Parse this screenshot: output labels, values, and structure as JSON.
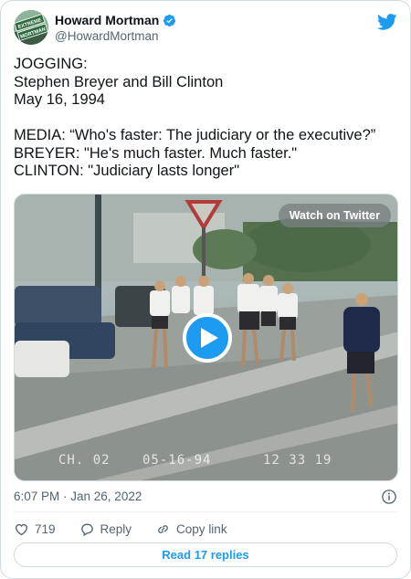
{
  "author": {
    "display_name": "Howard Mortman",
    "handle": "@HowardMortman",
    "verified": true,
    "avatar_text": [
      "EXTREME",
      "MORTMAN"
    ]
  },
  "tweet": {
    "lines": [
      "JOGGING:",
      "Stephen Breyer and Bill Clinton",
      "May 16, 1994",
      "",
      "MEDIA: “Who's faster: The judiciary or the executive?”",
      "BREYER: \"He's much faster. Much faster.\"",
      "CLINTON: \"Judiciary lasts longer\""
    ]
  },
  "media": {
    "watch_label": "Watch on Twitter",
    "vhs_channel": "CH. 02",
    "vhs_date": "05-16-94",
    "vhs_time": "12 33 19"
  },
  "meta": {
    "timestamp": "6:07 PM · Jan 26, 2022"
  },
  "actions": {
    "like_count": "719",
    "reply_label": "Reply",
    "copy_label": "Copy link"
  },
  "footer": {
    "replies_label": "Read 17 replies"
  },
  "colors": {
    "accent": "#1d9bf0",
    "text": "#0f1419",
    "secondary": "#536471",
    "border": "#cfd9de"
  }
}
